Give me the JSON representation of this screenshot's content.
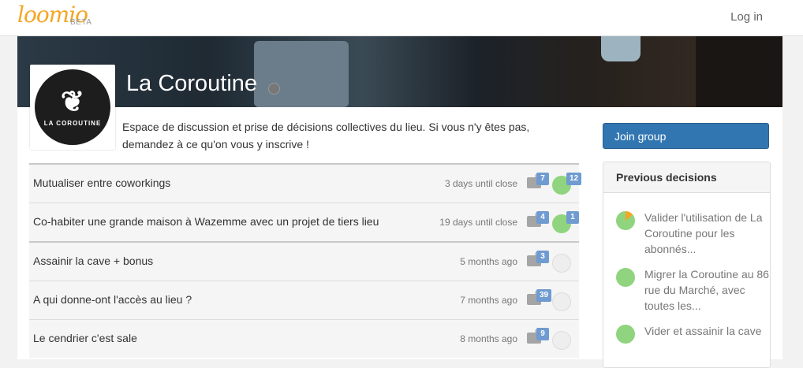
{
  "navbar": {
    "logo": "loomio",
    "beta": "BETA",
    "login": "Log in"
  },
  "group": {
    "name": "La Coroutine",
    "logo_text": "LA COROUTINE",
    "description": "Espace de discussion et prise de décisions collectives du lieu. Si vous n'y êtes pas, demandez à ce qu'on vous y inscrive !",
    "join_label": "Join group"
  },
  "discussions": [
    {
      "title": "Mutualiser entre coworkings",
      "time": "3 days until close",
      "comments": "7",
      "votes": "12"
    },
    {
      "title": "Co-habiter une grande maison à Wazemme avec un projet de tiers lieu",
      "time": "19 days until close",
      "comments": "4",
      "votes": "1"
    },
    {
      "title": "Assainir la cave + bonus",
      "time": "5 months ago",
      "comments": "3"
    },
    {
      "title": "A qui donne-ont l'accès au lieu ?",
      "time": "7 months ago",
      "comments": "39"
    },
    {
      "title": "Le cendrier c'est sale",
      "time": "8 months ago",
      "comments": "9"
    }
  ],
  "previous_decisions": {
    "header": "Previous decisions",
    "items": [
      {
        "text": "Valider l'utilisation de La Coroutine pour les abonnés..."
      },
      {
        "text": "Migrer la Coroutine au 86 rue du Marché, avec toutes les..."
      },
      {
        "text": "Vider et assainir la cave"
      }
    ]
  },
  "colors": {
    "accent": "#f5a623",
    "primary": "#3276b1",
    "badge": "#6f9bd1",
    "vote": "#90d47f"
  }
}
